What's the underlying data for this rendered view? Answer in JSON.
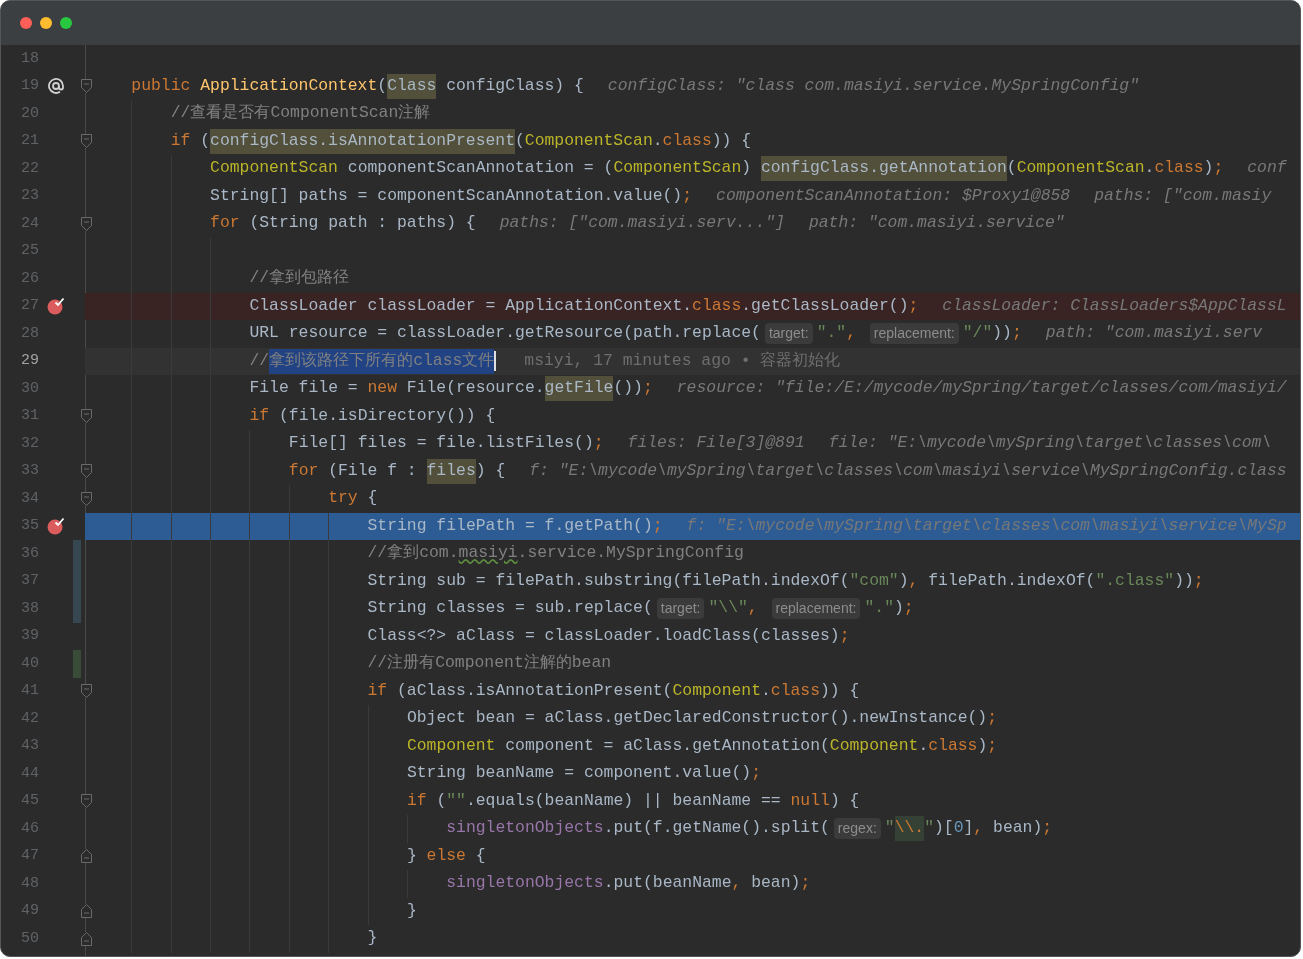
{
  "lines": [
    {
      "number": "18"
    },
    {
      "number": "19",
      "marker": {
        "kind": "override"
      },
      "fold": {
        "kind": "start"
      },
      "tokens": [
        {
          "kind": "keyword",
          "text": "public "
        },
        {
          "kind": "method",
          "text": "ApplicationContext"
        },
        {
          "kind": "plain",
          "text": "("
        },
        {
          "kind": "match",
          "text": "Class"
        },
        {
          "kind": "plain",
          "text": " configClass) {"
        },
        {
          "kind": "debug",
          "text": "configClass: \"class com.masiyi.service.MySpringConfig\""
        }
      ],
      "children": [
        {
          "number": "20",
          "tokens": [
            {
              "kind": "comment",
              "text": "//查看是否有ComponentScan注解"
            }
          ]
        },
        {
          "number": "21",
          "fold": {
            "kind": "start"
          },
          "tokens": [
            {
              "kind": "keyword",
              "text": "if "
            },
            {
              "kind": "plain",
              "text": "("
            },
            {
              "kind": "match",
              "text": "configClass.isAnnotationPresent"
            },
            {
              "kind": "plain",
              "text": "("
            },
            {
              "kind": "type",
              "text": "ComponentScan"
            },
            {
              "kind": "plain",
              "text": "."
            },
            {
              "kind": "keyword",
              "text": "class"
            },
            {
              "kind": "plain",
              "text": ")) {"
            }
          ],
          "children": [
            {
              "number": "22",
              "tokens": [
                {
                  "kind": "type",
                  "text": "ComponentScan"
                },
                {
                  "kind": "plain",
                  "text": " componentScanAnnotation = ("
                },
                {
                  "kind": "type",
                  "text": "ComponentScan"
                },
                {
                  "kind": "plain",
                  "text": ") "
                },
                {
                  "kind": "match",
                  "text": "configClass.getAnnotation"
                },
                {
                  "kind": "plain",
                  "text": "("
                },
                {
                  "kind": "type",
                  "text": "ComponentScan"
                },
                {
                  "kind": "plain",
                  "text": "."
                },
                {
                  "kind": "keyword",
                  "text": "class"
                },
                {
                  "kind": "plain",
                  "text": ")"
                },
                {
                  "kind": "keyword",
                  "text": ";"
                },
                {
                  "kind": "debug",
                  "text": "conf"
                }
              ]
            },
            {
              "number": "23",
              "tokens": [
                {
                  "kind": "plain",
                  "text": "String[] paths = componentScanAnnotation.value()"
                },
                {
                  "kind": "keyword",
                  "text": ";"
                },
                {
                  "kind": "debug",
                  "text": "componentScanAnnotation: $Proxy1@858"
                },
                {
                  "kind": "debug",
                  "text": "paths: [\"com.masiy"
                }
              ]
            },
            {
              "number": "24",
              "fold": {
                "kind": "start"
              },
              "tokens": [
                {
                  "kind": "keyword",
                  "text": "for "
                },
                {
                  "kind": "plain",
                  "text": "(String path : paths) {"
                },
                {
                  "kind": "debug",
                  "text": "paths: [\"com.masiyi.serv...\"]"
                },
                {
                  "kind": "debug",
                  "text": "path: \"com.masiyi.service\""
                }
              ],
              "children": [
                {
                  "number": "25"
                },
                {
                  "number": "26",
                  "tokens": [
                    {
                      "kind": "comment",
                      "text": "//拿到包路径"
                    }
                  ]
                },
                {
                  "number": "27",
                  "highlight": {
                    "kind": "breakpoint"
                  },
                  "marker": {
                    "kind": "breakpoint"
                  },
                  "tokens": [
                    {
                      "kind": "plain",
                      "text": "ClassLoader classLoader = ApplicationContext."
                    },
                    {
                      "kind": "keyword",
                      "text": "class"
                    },
                    {
                      "kind": "plain",
                      "text": ".getClassLoader()"
                    },
                    {
                      "kind": "keyword",
                      "text": ";"
                    },
                    {
                      "kind": "debug",
                      "text": "classLoader: ClassLoaders$AppClassL"
                    }
                  ]
                },
                {
                  "number": "28",
                  "tokens": [
                    {
                      "kind": "plain",
                      "text": "URL resource = classLoader.getResource(path.replace("
                    },
                    {
                      "kind": "param",
                      "text": "target:"
                    },
                    {
                      "kind": "string",
                      "text": "\".\""
                    },
                    {
                      "kind": "keyword",
                      "text": ", "
                    },
                    {
                      "kind": "param",
                      "text": "replacement:"
                    },
                    {
                      "kind": "string",
                      "text": "\"/\""
                    },
                    {
                      "kind": "plain",
                      "text": "))"
                    },
                    {
                      "kind": "keyword",
                      "text": ";"
                    },
                    {
                      "kind": "debug",
                      "text": "path: \"com.masiyi.serv"
                    }
                  ]
                },
                {
                  "number": "29",
                  "highlight": {
                    "kind": "caret"
                  },
                  "tokens": [
                    {
                      "kind": "comment",
                      "text": "//"
                    },
                    {
                      "kind": "selection",
                      "text": "拿到该路径下所有的class文件"
                    },
                    {
                      "kind": "blame",
                      "text": "msiyi, 17 minutes ago • 容器初始化"
                    }
                  ]
                },
                {
                  "number": "30",
                  "tokens": [
                    {
                      "kind": "plain",
                      "text": "File file = "
                    },
                    {
                      "kind": "keyword",
                      "text": "new "
                    },
                    {
                      "kind": "plain",
                      "text": "File(resource."
                    },
                    {
                      "kind": "match",
                      "text": "getFile"
                    },
                    {
                      "kind": "plain",
                      "text": "())"
                    },
                    {
                      "kind": "keyword",
                      "text": ";"
                    },
                    {
                      "kind": "debug",
                      "text": "resource: \"file:/E:/mycode/mySpring/target/classes/com/masiyi/"
                    }
                  ]
                },
                {
                  "number": "31",
                  "fold": {
                    "kind": "start"
                  },
                  "tokens": [
                    {
                      "kind": "keyword",
                      "text": "if "
                    },
                    {
                      "kind": "plain",
                      "text": "(file.isDirectory()) {"
                    }
                  ],
                  "children": [
                    {
                      "number": "32",
                      "tokens": [
                        {
                          "kind": "plain",
                          "text": "File[] files = file.listFiles()"
                        },
                        {
                          "kind": "keyword",
                          "text": ";"
                        },
                        {
                          "kind": "debug",
                          "text": "files: File[3]@891"
                        },
                        {
                          "kind": "debug",
                          "text": "file: \"E:\\mycode\\mySpring\\target\\classes\\com\\"
                        }
                      ]
                    },
                    {
                      "number": "33",
                      "fold": {
                        "kind": "start"
                      },
                      "tokens": [
                        {
                          "kind": "keyword",
                          "text": "for "
                        },
                        {
                          "kind": "plain",
                          "text": "(File f : "
                        },
                        {
                          "kind": "match",
                          "text": "files"
                        },
                        {
                          "kind": "plain",
                          "text": ") {"
                        },
                        {
                          "kind": "debug",
                          "text": "f: \"E:\\mycode\\mySpring\\target\\classes\\com\\masiyi\\service\\MySpringConfig.class"
                        }
                      ],
                      "children": [
                        {
                          "number": "34",
                          "fold": {
                            "kind": "start"
                          },
                          "tokens": [
                            {
                              "kind": "keyword",
                              "text": "try "
                            },
                            {
                              "kind": "plain",
                              "text": "{"
                            }
                          ],
                          "children": [
                            {
                              "number": "35",
                              "highlight": {
                                "kind": "execution"
                              },
                              "marker": {
                                "kind": "breakpoint"
                              },
                              "tokens": [
                                {
                                  "kind": "plain",
                                  "text": "String filePath = f.getPath()"
                                },
                                {
                                  "kind": "keyword",
                                  "text": ";"
                                },
                                {
                                  "kind": "debug",
                                  "text": "f: \"E:\\mycode\\mySpring\\target\\classes\\com\\masiyi\\service\\MySp"
                                }
                              ]
                            },
                            {
                              "number": "36",
                              "vcs": {
                                "kind": "modified"
                              },
                              "tokens": [
                                {
                                  "kind": "comment",
                                  "text": "//拿到com."
                                },
                                {
                                  "kind": "typo",
                                  "text": "masiyi"
                                },
                                {
                                  "kind": "comment",
                                  "text": ".service.MySpringConfig"
                                }
                              ]
                            },
                            {
                              "number": "37",
                              "vcs": {
                                "kind": "modified"
                              },
                              "tokens": [
                                {
                                  "kind": "plain",
                                  "text": "String sub = filePath.substring(filePath.indexOf("
                                },
                                {
                                  "kind": "string",
                                  "text": "\"com\""
                                },
                                {
                                  "kind": "plain",
                                  "text": ")"
                                },
                                {
                                  "kind": "keyword",
                                  "text": ", "
                                },
                                {
                                  "kind": "plain",
                                  "text": "filePath.indexOf("
                                },
                                {
                                  "kind": "string",
                                  "text": "\".class\""
                                },
                                {
                                  "kind": "plain",
                                  "text": "))"
                                },
                                {
                                  "kind": "keyword",
                                  "text": ";"
                                }
                              ]
                            },
                            {
                              "number": "38",
                              "vcs": {
                                "kind": "modified"
                              },
                              "tokens": [
                                {
                                  "kind": "plain",
                                  "text": "String classes = sub.replace("
                                },
                                {
                                  "kind": "param",
                                  "text": "target:"
                                },
                                {
                                  "kind": "string",
                                  "text": "\"\\\\\""
                                },
                                {
                                  "kind": "keyword",
                                  "text": ", "
                                },
                                {
                                  "kind": "param",
                                  "text": "replacement:"
                                },
                                {
                                  "kind": "string",
                                  "text": "\".\""
                                },
                                {
                                  "kind": "plain",
                                  "text": ")"
                                },
                                {
                                  "kind": "keyword",
                                  "text": ";"
                                }
                              ]
                            },
                            {
                              "number": "39",
                              "tokens": [
                                {
                                  "kind": "plain",
                                  "text": "Class<?> aClass = classLoader.loadClass(classes)"
                                },
                                {
                                  "kind": "keyword",
                                  "text": ";"
                                }
                              ]
                            },
                            {
                              "number": "40",
                              "vcs": {
                                "kind": "added"
                              },
                              "tokens": [
                                {
                                  "kind": "comment",
                                  "text": "//注册有Component注解的bean"
                                }
                              ]
                            },
                            {
                              "number": "41",
                              "fold": {
                                "kind": "start"
                              },
                              "tokens": [
                                {
                                  "kind": "keyword",
                                  "text": "if "
                                },
                                {
                                  "kind": "plain",
                                  "text": "(aClass.isAnnotationPresent("
                                },
                                {
                                  "kind": "type",
                                  "text": "Component"
                                },
                                {
                                  "kind": "plain",
                                  "text": "."
                                },
                                {
                                  "kind": "keyword",
                                  "text": "class"
                                },
                                {
                                  "kind": "plain",
                                  "text": ")) {"
                                }
                              ],
                              "children": [
                                {
                                  "number": "42",
                                  "tokens": [
                                    {
                                      "kind": "plain",
                                      "text": "Object bean = aClass.getDeclaredConstructor().newInstance()"
                                    },
                                    {
                                      "kind": "keyword",
                                      "text": ";"
                                    }
                                  ]
                                },
                                {
                                  "number": "43",
                                  "tokens": [
                                    {
                                      "kind": "type",
                                      "text": "Component"
                                    },
                                    {
                                      "kind": "plain",
                                      "text": " component = aClass.getAnnotation("
                                    },
                                    {
                                      "kind": "type",
                                      "text": "Component"
                                    },
                                    {
                                      "kind": "plain",
                                      "text": "."
                                    },
                                    {
                                      "kind": "keyword",
                                      "text": "class"
                                    },
                                    {
                                      "kind": "plain",
                                      "text": ")"
                                    },
                                    {
                                      "kind": "keyword",
                                      "text": ";"
                                    }
                                  ]
                                },
                                {
                                  "number": "44",
                                  "tokens": [
                                    {
                                      "kind": "plain",
                                      "text": "String beanName = component.value()"
                                    },
                                    {
                                      "kind": "keyword",
                                      "text": ";"
                                    }
                                  ]
                                },
                                {
                                  "number": "45",
                                  "fold": {
                                    "kind": "start"
                                  },
                                  "tokens": [
                                    {
                                      "kind": "keyword",
                                      "text": "if "
                                    },
                                    {
                                      "kind": "plain",
                                      "text": "("
                                    },
                                    {
                                      "kind": "string",
                                      "text": "\"\""
                                    },
                                    {
                                      "kind": "plain",
                                      "text": ".equals(beanName) || beanName == "
                                    },
                                    {
                                      "kind": "keyword",
                                      "text": "null"
                                    },
                                    {
                                      "kind": "plain",
                                      "text": ") {"
                                    }
                                  ],
                                  "children": [
                                    {
                                      "number": "46",
                                      "tokens": [
                                        {
                                          "kind": "field",
                                          "text": "singletonObjects"
                                        },
                                        {
                                          "kind": "plain",
                                          "text": ".put(f.getName().split("
                                        },
                                        {
                                          "kind": "param",
                                          "text": "regex:"
                                        },
                                        {
                                          "kind": "string",
                                          "text": "\""
                                        },
                                        {
                                          "kind": "escape",
                                          "text": "\\\\."
                                        },
                                        {
                                          "kind": "string",
                                          "text": "\""
                                        },
                                        {
                                          "kind": "plain",
                                          "text": ")["
                                        },
                                        {
                                          "kind": "number",
                                          "text": "0"
                                        },
                                        {
                                          "kind": "plain",
                                          "text": "]"
                                        },
                                        {
                                          "kind": "keyword",
                                          "text": ", "
                                        },
                                        {
                                          "kind": "plain",
                                          "text": "bean)"
                                        },
                                        {
                                          "kind": "keyword",
                                          "text": ";"
                                        }
                                      ]
                                    }
                                  ]
                                },
                                {
                                  "number": "47",
                                  "fold": {
                                    "kind": "end"
                                  },
                                  "tokens": [
                                    {
                                      "kind": "plain",
                                      "text": "} "
                                    },
                                    {
                                      "kind": "keyword",
                                      "text": "else "
                                    },
                                    {
                                      "kind": "plain",
                                      "text": "{"
                                    }
                                  ],
                                  "children": [
                                    {
                                      "number": "48",
                                      "tokens": [
                                        {
                                          "kind": "field",
                                          "text": "singletonObjects"
                                        },
                                        {
                                          "kind": "plain",
                                          "text": ".put(beanName"
                                        },
                                        {
                                          "kind": "keyword",
                                          "text": ", "
                                        },
                                        {
                                          "kind": "plain",
                                          "text": "bean)"
                                        },
                                        {
                                          "kind": "keyword",
                                          "text": ";"
                                        }
                                      ]
                                    }
                                  ]
                                },
                                {
                                  "number": "49",
                                  "fold": {
                                    "kind": "end"
                                  },
                                  "tokens": [
                                    {
                                      "kind": "plain",
                                      "text": "}"
                                    }
                                  ]
                                }
                              ]
                            },
                            {
                              "number": "50",
                              "fold": {
                                "kind": "end"
                              },
                              "tokens": [
                                {
                                  "kind": "plain",
                                  "text": "}"
                                }
                              ]
                            }
                          ]
                        }
                      ]
                    }
                  ]
                }
              ]
            }
          ]
        }
      ]
    }
  ]
}
